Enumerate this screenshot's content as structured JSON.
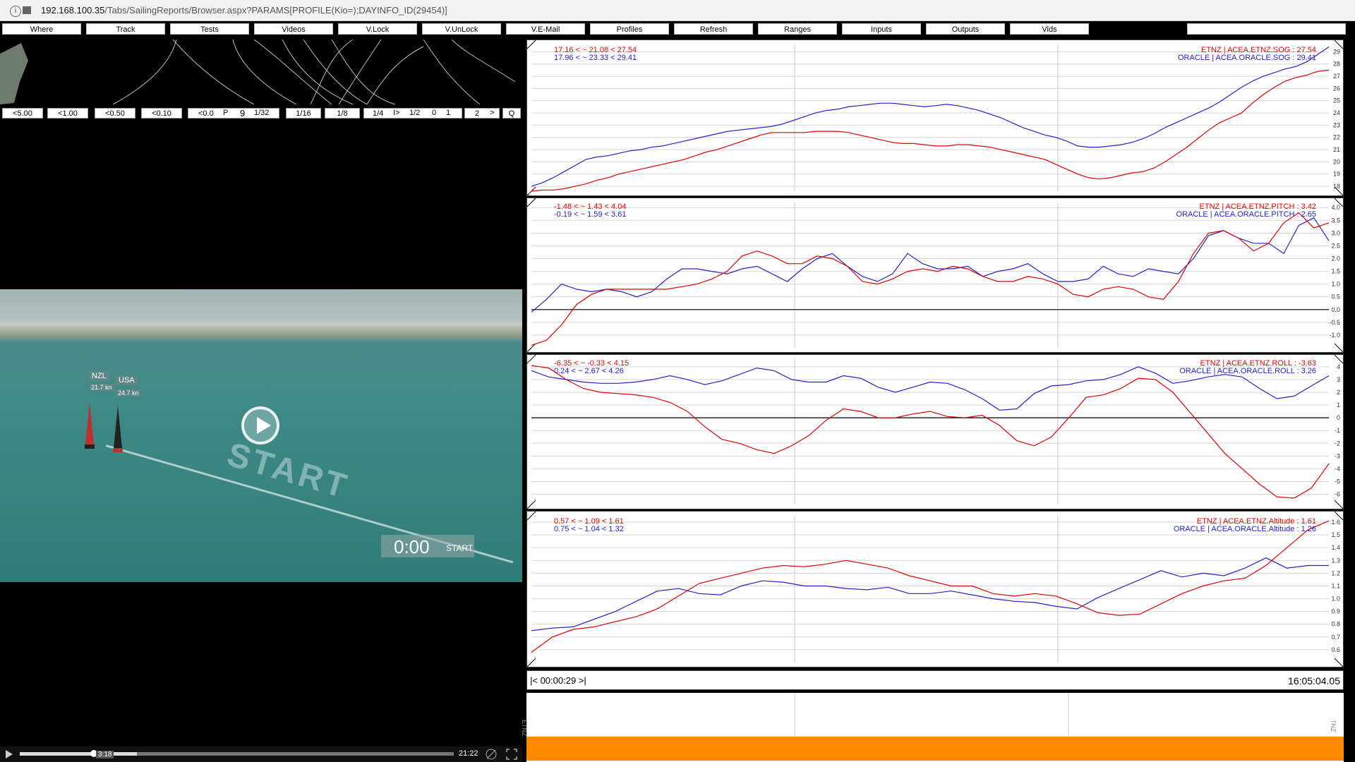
{
  "browser": {
    "url_host": "192.168.100.35",
    "url_path": "/Tabs/SailingReports/Browser.aspx?PARAMS[PROFILE(Kio=);DAYINFO_ID(29454)]"
  },
  "toolbar": [
    "Where",
    "Track",
    "Tests",
    "Videos",
    "V.Lock",
    "V.UnLock",
    "V.E-Mail",
    "Profiles",
    "Refresh",
    "Ranges",
    "Inputs",
    "Outputs",
    "Vids"
  ],
  "speed_buttons": [
    "<5.00",
    "<1.00",
    "<0.50",
    "<0.10",
    "<0.0",
    "P",
    "9",
    "1/32",
    "1/16",
    "1/8",
    "1/4",
    "I>",
    "1/2",
    "0",
    "1",
    "2",
    ">",
    "Q"
  ],
  "video": {
    "start_text": "START",
    "clock": "0:00",
    "clock_label": "START",
    "boats": [
      {
        "label": "NZL",
        "dist": "21.7 kn"
      },
      {
        "label": "USA",
        "dist": "24.7 kn"
      }
    ],
    "current_time": "3:18",
    "duration": "21:22",
    "progress": 0.27
  },
  "colors": {
    "etnz": "#e00000",
    "oracle": "#2222cc",
    "timeline": "#ff8c00"
  },
  "panels": [
    {
      "etnz_stats": "17.16 < ~ 21.08 < 27.54",
      "oracle_stats": "17.96 < ~ 23.33 < 29.41",
      "etnz_legend": "ETNZ | ACEA.ETNZ.SOG : 27.54",
      "oracle_legend": "ORACLE | ACEA.ORACLE.SOG : 29.41",
      "ylim": [
        17.6,
        29.6
      ],
      "ticks": [
        "29",
        "28",
        "27",
        "26",
        "25",
        "24",
        "23",
        "22",
        "21",
        "20",
        "19",
        "18"
      ],
      "zero": null,
      "etnz": [
        17.6,
        17.7,
        17.7,
        17.8,
        18.0,
        18.2,
        18.5,
        18.7,
        19.0,
        19.2,
        19.4,
        19.6,
        19.8,
        20.0,
        20.2,
        20.5,
        20.8,
        21.0,
        21.3,
        21.6,
        21.9,
        22.2,
        22.4,
        22.4,
        22.4,
        22.4,
        22.5,
        22.5,
        22.5,
        22.4,
        22.2,
        22.0,
        21.8,
        21.6,
        21.5,
        21.5,
        21.4,
        21.3,
        21.3,
        21.4,
        21.4,
        21.3,
        21.2,
        21.0,
        20.8,
        20.6,
        20.4,
        20.2,
        19.8,
        19.4,
        19.0,
        18.7,
        18.6,
        18.7,
        18.9,
        19.1,
        19.2,
        19.5,
        20.0,
        20.6,
        21.2,
        21.9,
        22.6,
        23.2,
        23.6,
        24.0,
        24.8,
        25.5,
        26.1,
        26.6,
        26.9,
        27.1,
        27.4,
        27.5
      ],
      "oracle": [
        18.0,
        18.3,
        18.7,
        19.2,
        19.7,
        20.2,
        20.4,
        20.5,
        20.7,
        20.9,
        21.0,
        21.2,
        21.3,
        21.5,
        21.7,
        21.9,
        22.1,
        22.3,
        22.5,
        22.6,
        22.7,
        22.8,
        22.9,
        23.1,
        23.4,
        23.7,
        24.0,
        24.2,
        24.3,
        24.5,
        24.6,
        24.7,
        24.8,
        24.8,
        24.7,
        24.6,
        24.5,
        24.6,
        24.7,
        24.6,
        24.4,
        24.2,
        23.9,
        23.6,
        23.2,
        22.8,
        22.5,
        22.2,
        22.0,
        21.7,
        21.3,
        21.2,
        21.2,
        21.3,
        21.4,
        21.6,
        21.9,
        22.3,
        22.8,
        23.2,
        23.6,
        24.0,
        24.4,
        24.9,
        25.5,
        26.1,
        26.6,
        27.0,
        27.3,
        27.6,
        27.8,
        28.2,
        28.8,
        29.4
      ]
    },
    {
      "etnz_stats": "-1.48 < ~ 1.43 < 4.04",
      "oracle_stats": "-0.19 < ~ 1.59 < 3.61",
      "etnz_legend": "ETNZ | ACEA.ETNZ.PITCH : 3.42",
      "oracle_legend": "ORACLE | ACEA.ORACLE.PITCH : 2.65",
      "ylim": [
        -1.5,
        4.2
      ],
      "ticks": [
        "4.0",
        "3.5",
        "3.0",
        "2.5",
        "2.0",
        "1.5",
        "1.0",
        "0.5",
        "0.0",
        "-0.5",
        "-1.0"
      ],
      "zero": 0,
      "etnz": [
        -1.4,
        -1.2,
        -0.6,
        0.2,
        0.6,
        0.8,
        0.8,
        0.8,
        0.8,
        0.8,
        0.9,
        1.0,
        1.2,
        1.5,
        2.1,
        2.3,
        2.1,
        1.8,
        1.8,
        2.1,
        2.0,
        1.7,
        1.1,
        1.0,
        1.2,
        1.5,
        1.6,
        1.5,
        1.7,
        1.6,
        1.3,
        1.1,
        1.1,
        1.3,
        1.2,
        1.0,
        0.6,
        0.5,
        0.8,
        0.9,
        0.8,
        0.5,
        0.4,
        1.1,
        2.2,
        3.0,
        3.1,
        2.8,
        2.3,
        2.6,
        3.4,
        3.8,
        3.2,
        3.4
      ],
      "oracle": [
        -0.1,
        0.4,
        1.0,
        0.8,
        0.7,
        0.8,
        0.7,
        0.5,
        0.7,
        1.2,
        1.6,
        1.6,
        1.5,
        1.4,
        1.6,
        1.7,
        1.4,
        1.1,
        1.6,
        2.0,
        2.2,
        1.7,
        1.3,
        1.1,
        1.4,
        2.2,
        1.8,
        1.6,
        1.6,
        1.7,
        1.3,
        1.5,
        1.6,
        1.8,
        1.4,
        1.1,
        1.1,
        1.2,
        1.7,
        1.4,
        1.3,
        1.6,
        1.5,
        1.4,
        2.0,
        2.9,
        3.1,
        2.8,
        2.6,
        2.6,
        2.2,
        3.3,
        3.6,
        2.7
      ]
    },
    {
      "etnz_stats": "-6.35 < ~ -0.33 < 4.15",
      "oracle_stats": "0.24 < ~ 2.67 < 4.26",
      "etnz_legend": "ETNZ | ACEA.ETNZ.ROLL : -3.63",
      "oracle_legend": "ORACLE | ACEA.ORACLE.ROLL : 3.26",
      "ylim": [
        -6.8,
        4.6
      ],
      "ticks": [
        "4",
        "3",
        "2",
        "1",
        "0",
        "-1",
        "-2",
        "-3",
        "-4",
        "-5",
        "-6"
      ],
      "zero": 0,
      "etnz": [
        4.1,
        3.9,
        3.0,
        2.3,
        2.0,
        1.9,
        1.8,
        1.6,
        1.2,
        0.5,
        -0.7,
        -1.7,
        -2.0,
        -2.5,
        -2.8,
        -2.2,
        -1.4,
        -0.2,
        0.7,
        0.5,
        0.0,
        0.0,
        0.3,
        0.5,
        0.1,
        0.0,
        0.2,
        -0.6,
        -1.8,
        -2.2,
        -1.5,
        0.0,
        1.6,
        1.8,
        2.3,
        3.1,
        3.0,
        2.0,
        0.4,
        -1.2,
        -2.8,
        -4.0,
        -5.2,
        -6.2,
        -6.3,
        -5.5,
        -3.6
      ],
      "oracle": [
        3.7,
        3.2,
        3.0,
        2.8,
        2.7,
        2.7,
        2.8,
        3.0,
        3.3,
        3.0,
        2.6,
        2.9,
        3.4,
        3.9,
        3.7,
        3.0,
        2.8,
        2.8,
        3.3,
        3.1,
        2.4,
        2.0,
        2.4,
        2.8,
        2.7,
        2.2,
        1.5,
        0.6,
        0.7,
        1.9,
        2.5,
        2.6,
        2.9,
        3.0,
        3.4,
        4.0,
        3.5,
        2.7,
        2.9,
        3.2,
        3.4,
        3.2,
        2.3,
        1.5,
        1.7,
        2.5,
        3.3
      ]
    },
    {
      "etnz_stats": "0.57 < ~ 1.09 < 1.61",
      "oracle_stats": "0.75 < ~ 1.04 < 1.32",
      "etnz_legend": "ETNZ | ACEA.ETNZ.Altitude : 1.61",
      "oracle_legend": "ORACLE | ACEA.ORACLE.Altitude : 1.26",
      "ylim": [
        0.5,
        1.65
      ],
      "ticks": [
        "1.6",
        "1.5",
        "1.4",
        "1.3",
        "1.2",
        "1.1",
        "1.0",
        "0.9",
        "0.8",
        "0.7",
        "0.6"
      ],
      "zero": null,
      "etnz": [
        0.58,
        0.7,
        0.76,
        0.78,
        0.82,
        0.86,
        0.92,
        1.02,
        1.12,
        1.16,
        1.2,
        1.24,
        1.26,
        1.25,
        1.27,
        1.3,
        1.27,
        1.24,
        1.18,
        1.14,
        1.1,
        1.1,
        1.04,
        1.02,
        1.04,
        1.02,
        0.96,
        0.89,
        0.87,
        0.88,
        0.96,
        1.04,
        1.1,
        1.14,
        1.16,
        1.26,
        1.4,
        1.54,
        1.61
      ],
      "oracle": [
        0.75,
        0.77,
        0.78,
        0.84,
        0.9,
        0.98,
        1.06,
        1.08,
        1.04,
        1.03,
        1.1,
        1.14,
        1.13,
        1.1,
        1.1,
        1.08,
        1.07,
        1.09,
        1.04,
        1.04,
        1.06,
        1.03,
        1.0,
        0.98,
        0.97,
        0.94,
        0.92,
        1.01,
        1.08,
        1.15,
        1.22,
        1.17,
        1.2,
        1.18,
        1.24,
        1.32,
        1.24,
        1.26,
        1.26
      ]
    }
  ],
  "timeline": {
    "left_label": "|< 00:00:29  >|",
    "right_label": "16:05:04.05",
    "side_left": "ETNZ",
    "side_right": "TNZ"
  }
}
